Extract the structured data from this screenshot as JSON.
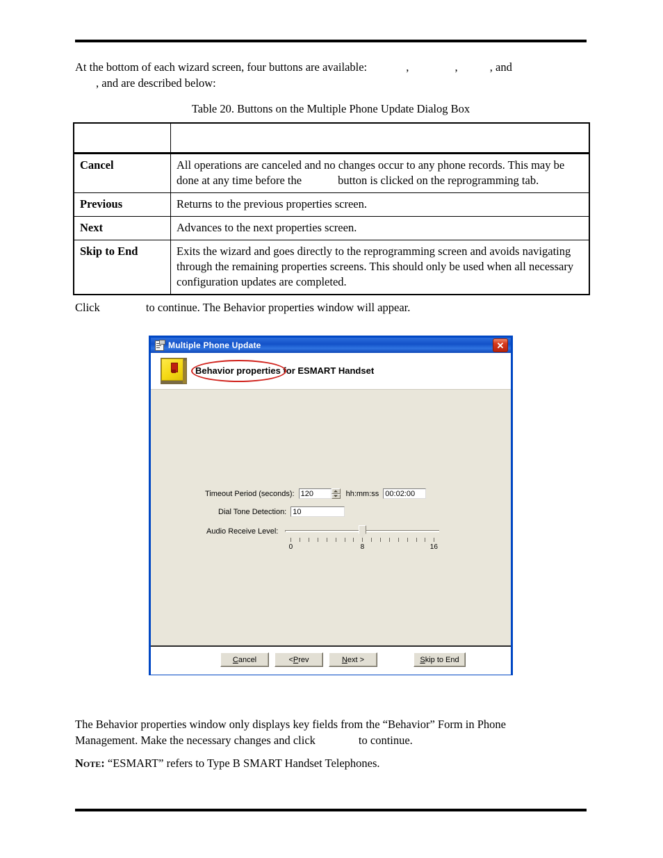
{
  "document": {
    "intro": {
      "line1_before": "At the bottom of each wizard screen, four buttons are available:",
      "sep_comma_1": ",",
      "sep_comma_2": ",",
      "sep_and": ", and",
      "line2": ", and are described below:"
    },
    "table_caption": "Table 20.  Buttons on the Multiple Phone Update Dialog Box",
    "table": {
      "header": {
        "col1": "",
        "col2": ""
      },
      "rows": [
        {
          "label": "Cancel",
          "desc_part1": "All operations are canceled and no changes occur to any phone records.  This may be done at any time before the",
          "desc_part2": "button is clicked on the reprogramming tab."
        },
        {
          "label": "Previous",
          "desc_part1": "Returns to the previous properties screen.",
          "desc_part2": ""
        },
        {
          "label": "Next",
          "desc_part1": "Advances to the next properties screen.",
          "desc_part2": ""
        },
        {
          "label": "Skip to End",
          "desc_part1": "Exits the wizard and goes directly to the reprogramming screen and avoids navigating through the remaining properties screens.  This should only be used when all necessary configuration updates are completed.",
          "desc_part2": ""
        }
      ]
    },
    "click_line": {
      "before": "Click",
      "after": "to continue.  The Behavior properties window will appear."
    },
    "closing_para": {
      "part1": "The Behavior properties window only displays key fields from the “Behavior” Form in Phone Management.  Make the necessary changes and click",
      "part2": "to continue."
    },
    "note": {
      "label": "Note:",
      "text": "“ESMART” refers to Type B SMART Handset Telephones."
    }
  },
  "dialog": {
    "titlebar": {
      "title": "Multiple Phone Update",
      "close_label": "✕",
      "icon": "document-properties-icon",
      "bg_color": "#1351c8"
    },
    "header": {
      "icon": "phone-device-icon",
      "text": "Behavior properties for ESMART Handset",
      "annotation_color": "#d0201a"
    },
    "body": {
      "bg_color": "#e9e6da",
      "fields": {
        "timeout": {
          "label": "Timeout Period (seconds):",
          "value": "120",
          "hhmmss_label": "hh:mm:ss",
          "hhmmss_value": "00:02:00"
        },
        "dial_tone": {
          "label": "Dial Tone Detection:",
          "value": "10"
        },
        "audio_receive": {
          "label": "Audio Receive Level:",
          "value": 8,
          "min": 0,
          "max": 16,
          "scale_labels": [
            "0",
            "8",
            "16"
          ]
        }
      }
    },
    "footer": {
      "buttons": [
        {
          "name": "cancel",
          "accel": "C",
          "rest": "ancel",
          "prefix": ""
        },
        {
          "name": "prev",
          "accel": "P",
          "rest": "rev",
          "prefix": "< "
        },
        {
          "name": "next",
          "accel": "N",
          "rest": "ext >",
          "prefix": ""
        },
        {
          "name": "skip",
          "accel": "S",
          "rest": "kip to End",
          "prefix": ""
        }
      ]
    }
  }
}
